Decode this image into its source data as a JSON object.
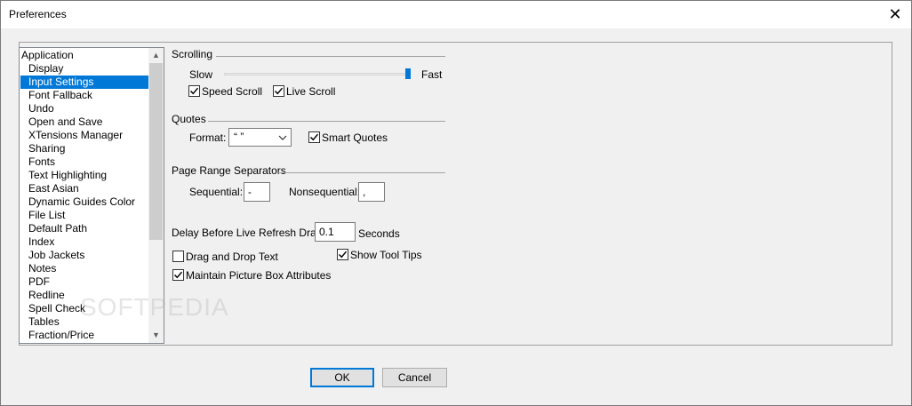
{
  "window": {
    "title": "Preferences"
  },
  "sidebar": {
    "items": [
      {
        "label": "Application",
        "indent": false
      },
      {
        "label": "Display",
        "indent": true
      },
      {
        "label": "Input Settings",
        "indent": true,
        "selected": true
      },
      {
        "label": "Font Fallback",
        "indent": true
      },
      {
        "label": "Undo",
        "indent": true
      },
      {
        "label": "Open and Save",
        "indent": true
      },
      {
        "label": "XTensions Manager",
        "indent": true
      },
      {
        "label": "Sharing",
        "indent": true
      },
      {
        "label": "Fonts",
        "indent": true
      },
      {
        "label": "Text Highlighting",
        "indent": true
      },
      {
        "label": "East Asian",
        "indent": true
      },
      {
        "label": "Dynamic Guides Color",
        "indent": true
      },
      {
        "label": "File List",
        "indent": true
      },
      {
        "label": "Default Path",
        "indent": true
      },
      {
        "label": "Index",
        "indent": true
      },
      {
        "label": "Job Jackets",
        "indent": true
      },
      {
        "label": "Notes",
        "indent": true
      },
      {
        "label": "PDF",
        "indent": true
      },
      {
        "label": "Redline",
        "indent": true
      },
      {
        "label": "Spell Check",
        "indent": true
      },
      {
        "label": "Tables",
        "indent": true
      },
      {
        "label": "Fraction/Price",
        "indent": true
      }
    ]
  },
  "scrolling": {
    "heading": "Scrolling",
    "slow_label": "Slow",
    "fast_label": "Fast",
    "speed_level": 1.0,
    "speed_scroll": {
      "label": "Speed Scroll",
      "checked": true
    },
    "live_scroll": {
      "label": "Live Scroll",
      "checked": true
    }
  },
  "quotes": {
    "heading": "Quotes",
    "format_label": "Format:",
    "format_value": "“ ”",
    "smart_quotes": {
      "label": "Smart Quotes",
      "checked": true
    }
  },
  "page_range": {
    "heading": "Page Range Separators",
    "sequential_label": "Sequential:",
    "sequential_value": "-",
    "nonsequential_label": "Nonsequential:",
    "nonsequential_value": ","
  },
  "delay": {
    "label": "Delay Before Live Refresh Drag:",
    "value": "0.1",
    "unit": "Seconds"
  },
  "options": {
    "drag_drop": {
      "label": "Drag and Drop Text",
      "checked": false
    },
    "show_tooltips": {
      "label": "Show Tool Tips",
      "checked": true
    },
    "maintain_picture": {
      "label": "Maintain Picture Box Attributes",
      "checked": true
    }
  },
  "buttons": {
    "ok": "OK",
    "cancel": "Cancel"
  },
  "watermark": "SOFTPEDIA",
  "colors": {
    "accent": "#0078d7",
    "window_bg": "#f0f0f0"
  }
}
